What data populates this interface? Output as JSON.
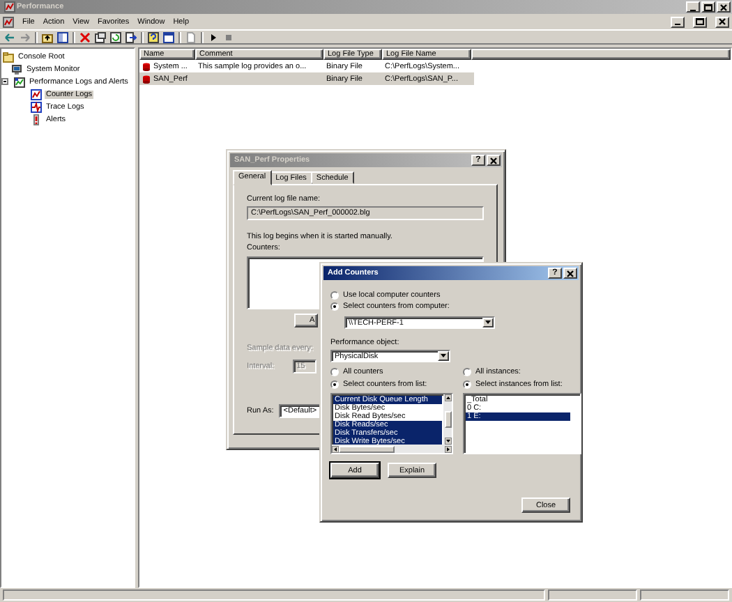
{
  "window": {
    "title": "Performance",
    "active": false
  },
  "menu": [
    "File",
    "Action",
    "View",
    "Favorites",
    "Window",
    "Help"
  ],
  "tree": [
    {
      "label": "Console Root",
      "kind": "root",
      "selected": false,
      "children": [
        {
          "label": "System Monitor",
          "kind": "monitor",
          "selected": false
        },
        {
          "label": "Performance Logs and Alerts",
          "kind": "logs",
          "selected": false,
          "expanded": true,
          "children": [
            {
              "label": "Counter Logs",
              "kind": "counter",
              "selected": true
            },
            {
              "label": "Trace Logs",
              "kind": "trace",
              "selected": false
            },
            {
              "label": "Alerts",
              "kind": "alert",
              "selected": false
            }
          ]
        }
      ]
    }
  ],
  "list": {
    "columns": [
      "Name",
      "Comment",
      "Log File Type",
      "Log File Name"
    ],
    "rows": [
      {
        "name": "System ...",
        "comment": "This sample log provides an o...",
        "type": "Binary File",
        "file": "C:\\PerfLogs\\System...",
        "selected": false
      },
      {
        "name": "SAN_Perf",
        "type": "Binary File",
        "file": "C:\\PerfLogs\\SAN_P...",
        "selected": true
      }
    ]
  },
  "properties": {
    "title": "SAN_Perf Properties",
    "active": false,
    "help": "?",
    "tabs": [
      {
        "label": "General",
        "selected": true
      },
      {
        "label": "Log Files",
        "selected": false
      },
      {
        "label": "Schedule",
        "selected": false
      }
    ],
    "file_label": "Current log file name:",
    "file_name": "C:\\PerfLogs\\SAN_Perf_000002.blg",
    "start_note": "This log begins when it is started manually.",
    "counters_label": "Counters:",
    "add_button": "A",
    "sample_label": "Sample data every:",
    "interval_label": "Interval:",
    "interval": "15",
    "sampling_disabled": true,
    "run_as_label": "Run As:",
    "run_as": "<Default>"
  },
  "add_counters": {
    "title": "Add Counters",
    "active": true,
    "help": "?",
    "source": [
      {
        "label": "Use local computer counters",
        "selected": false
      },
      {
        "label": "Select counters from computer:",
        "selected": true
      }
    ],
    "computer": "\\\\TECH-PERF-1",
    "object_label": "Performance object:",
    "object": "PhysicalDisk",
    "counter_mode": [
      {
        "label": "All counters",
        "selected": false
      },
      {
        "label": "Select counters from list:",
        "selected": true
      }
    ],
    "instance_mode": [
      {
        "label": "All instances:",
        "selected": false
      },
      {
        "label": "Select instances from list:",
        "selected": true
      }
    ],
    "counters": [
      {
        "label": "Current Disk Queue Length",
        "selected": true
      },
      {
        "label": "Disk Bytes/sec",
        "selected": false
      },
      {
        "label": "Disk Read Bytes/sec",
        "selected": false
      },
      {
        "label": "Disk Reads/sec",
        "selected": true
      },
      {
        "label": "Disk Transfers/sec",
        "selected": true
      },
      {
        "label": "Disk Write Bytes/sec",
        "selected": true
      }
    ],
    "instances": [
      {
        "label": "_Total",
        "selected": false
      },
      {
        "label": "0 C:",
        "selected": false
      },
      {
        "label": "1 E:",
        "selected": true
      }
    ],
    "add_button": "Add",
    "explain_button": "Explain",
    "close_button": "Close"
  }
}
